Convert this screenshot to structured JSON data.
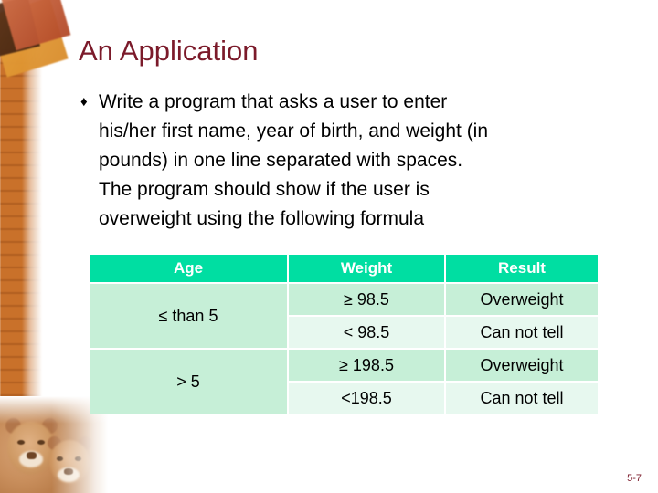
{
  "slide": {
    "title": "An Application",
    "page_number": "5-7",
    "accent_color": "#7B1A2A",
    "table_header_color": "#00DEA2",
    "table_row_dark_color": "#C6EFD7",
    "table_row_light_color": "#E7F8EF",
    "band_color": "#C9712A"
  },
  "bullet": {
    "glyph": "♦",
    "lines": [
      "Write a program that asks a user to enter",
      "his/her first name, year of birth, and weight (in",
      "pounds) in one line separated with spaces.",
      "The program should show if the user is",
      "overweight using the following formula"
    ]
  },
  "table": {
    "headers": [
      "Age",
      "Weight",
      "Result"
    ],
    "groups": [
      {
        "age": "≤ than 5",
        "rows": [
          {
            "weight": "≥ 98.5",
            "result": "Overweight"
          },
          {
            "weight": "< 98.5",
            "result": "Can not tell"
          }
        ]
      },
      {
        "age": "> 5",
        "rows": [
          {
            "weight": "≥ 198.5",
            "result": "Overweight"
          },
          {
            "weight": "<198.5",
            "result": "Can not tell"
          }
        ]
      }
    ]
  },
  "decorations": {
    "corner_squares_label": "rotated-squares-graphic",
    "left_band_label": "orange-striped-band",
    "photo_label": "lioness-and-cub-photo"
  }
}
